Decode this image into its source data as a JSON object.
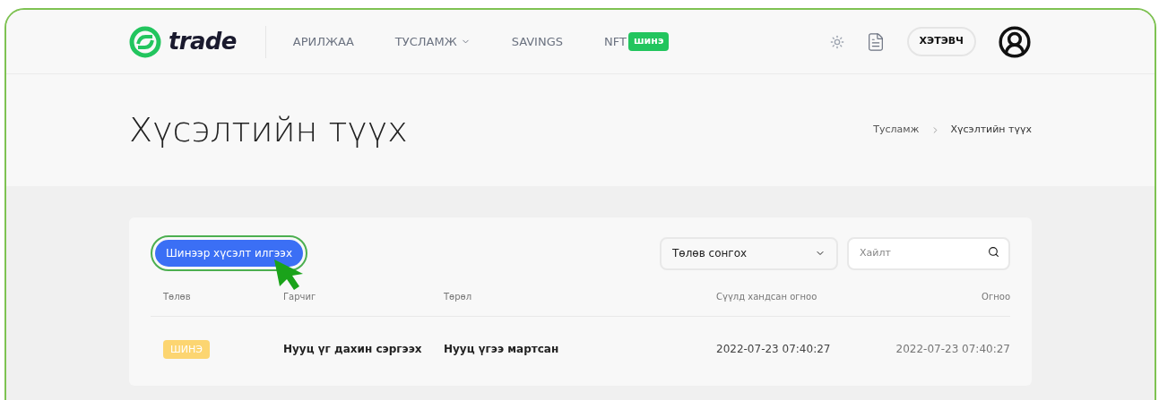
{
  "header": {
    "logo": "trade",
    "nav": [
      {
        "label": "АРИЛЖАА",
        "kind": "link"
      },
      {
        "label": "ТУСЛАМЖ",
        "kind": "dropdown"
      },
      {
        "label": "SAVINGS",
        "kind": "link"
      },
      {
        "label": "NFT",
        "kind": "badged",
        "badge": "шинэ"
      }
    ],
    "login_button": "ХЭТЭВЧ"
  },
  "page": {
    "title": "Хүсэлтийн түүх",
    "breadcrumb": [
      "Тусламж",
      "Хүсэлтийн түүх"
    ]
  },
  "toolbar": {
    "new_request_button": "Шинээр хүсэлт илгээх",
    "status_select": "Төлөв сонгох",
    "search": {
      "placeholder": "Хайлт"
    }
  },
  "table": {
    "columns": [
      "Төлөв",
      "Гарчиг",
      "Төрөл",
      "Сүүлд хандсан огноо",
      "Огноо"
    ],
    "rows": [
      {
        "status": {
          "label": "ШИНЭ",
          "color": "#fcd571"
        },
        "title": "Нууц үг дахин сэргээх",
        "type": "Нууц үгээ мартсан",
        "last_accessed": "2022-07-23 07:40:27",
        "date": "2022-07-23 07:40:27"
      }
    ]
  }
}
